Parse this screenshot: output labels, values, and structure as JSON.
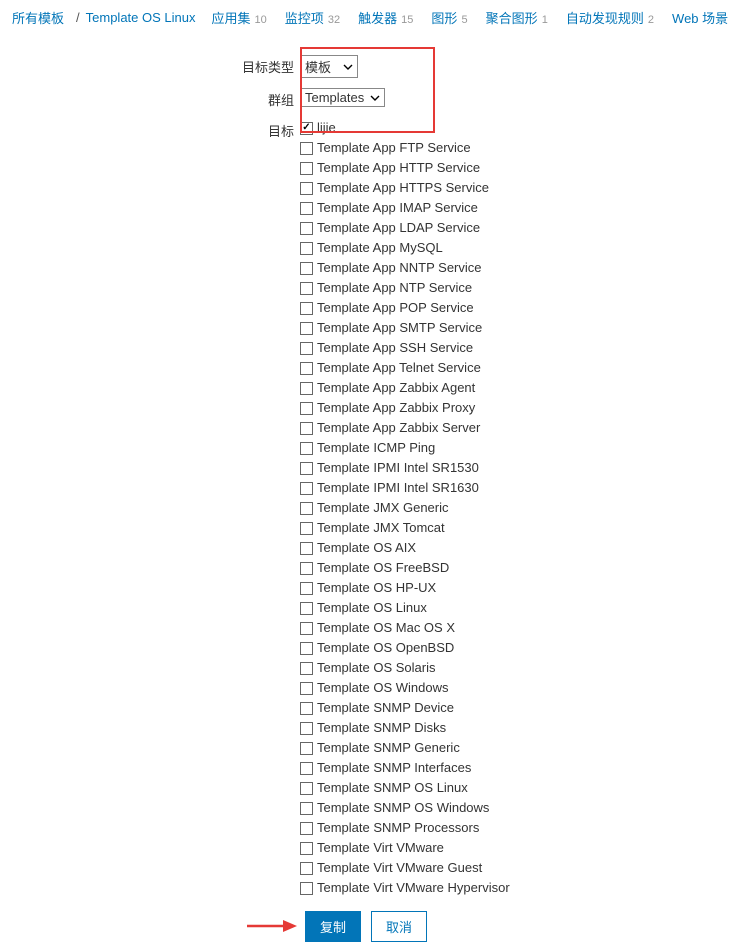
{
  "nav": {
    "all_templates": "所有模板",
    "current_template": "Template OS Linux",
    "items": [
      {
        "label": "应用集",
        "count": "10"
      },
      {
        "label": "监控项",
        "count": "32"
      },
      {
        "label": "触发器",
        "count": "15"
      },
      {
        "label": "图形",
        "count": "5"
      },
      {
        "label": "聚合图形",
        "count": "1"
      },
      {
        "label": "自动发现规则",
        "count": "2"
      },
      {
        "label": "Web 场景",
        "count": ""
      }
    ]
  },
  "form": {
    "target_type_label": "目标类型",
    "target_type_value": "模板",
    "group_label": "群组",
    "group_value": "Templates",
    "target_label": "目标",
    "targets": [
      {
        "label": "lijie",
        "checked": true
      },
      {
        "label": "Template App FTP Service",
        "checked": false
      },
      {
        "label": "Template App HTTP Service",
        "checked": false
      },
      {
        "label": "Template App HTTPS Service",
        "checked": false
      },
      {
        "label": "Template App IMAP Service",
        "checked": false
      },
      {
        "label": "Template App LDAP Service",
        "checked": false
      },
      {
        "label": "Template App MySQL",
        "checked": false
      },
      {
        "label": "Template App NNTP Service",
        "checked": false
      },
      {
        "label": "Template App NTP Service",
        "checked": false
      },
      {
        "label": "Template App POP Service",
        "checked": false
      },
      {
        "label": "Template App SMTP Service",
        "checked": false
      },
      {
        "label": "Template App SSH Service",
        "checked": false
      },
      {
        "label": "Template App Telnet Service",
        "checked": false
      },
      {
        "label": "Template App Zabbix Agent",
        "checked": false
      },
      {
        "label": "Template App Zabbix Proxy",
        "checked": false
      },
      {
        "label": "Template App Zabbix Server",
        "checked": false
      },
      {
        "label": "Template ICMP Ping",
        "checked": false
      },
      {
        "label": "Template IPMI Intel SR1530",
        "checked": false
      },
      {
        "label": "Template IPMI Intel SR1630",
        "checked": false
      },
      {
        "label": "Template JMX Generic",
        "checked": false
      },
      {
        "label": "Template JMX Tomcat",
        "checked": false
      },
      {
        "label": "Template OS AIX",
        "checked": false
      },
      {
        "label": "Template OS FreeBSD",
        "checked": false
      },
      {
        "label": "Template OS HP-UX",
        "checked": false
      },
      {
        "label": "Template OS Linux",
        "checked": false
      },
      {
        "label": "Template OS Mac OS X",
        "checked": false
      },
      {
        "label": "Template OS OpenBSD",
        "checked": false
      },
      {
        "label": "Template OS Solaris",
        "checked": false
      },
      {
        "label": "Template OS Windows",
        "checked": false
      },
      {
        "label": "Template SNMP Device",
        "checked": false
      },
      {
        "label": "Template SNMP Disks",
        "checked": false
      },
      {
        "label": "Template SNMP Generic",
        "checked": false
      },
      {
        "label": "Template SNMP Interfaces",
        "checked": false
      },
      {
        "label": "Template SNMP OS Linux",
        "checked": false
      },
      {
        "label": "Template SNMP OS Windows",
        "checked": false
      },
      {
        "label": "Template SNMP Processors",
        "checked": false
      },
      {
        "label": "Template Virt VMware",
        "checked": false
      },
      {
        "label": "Template Virt VMware Guest",
        "checked": false
      },
      {
        "label": "Template Virt VMware Hypervisor",
        "checked": false
      }
    ]
  },
  "buttons": {
    "copy": "复制",
    "cancel": "取消"
  }
}
